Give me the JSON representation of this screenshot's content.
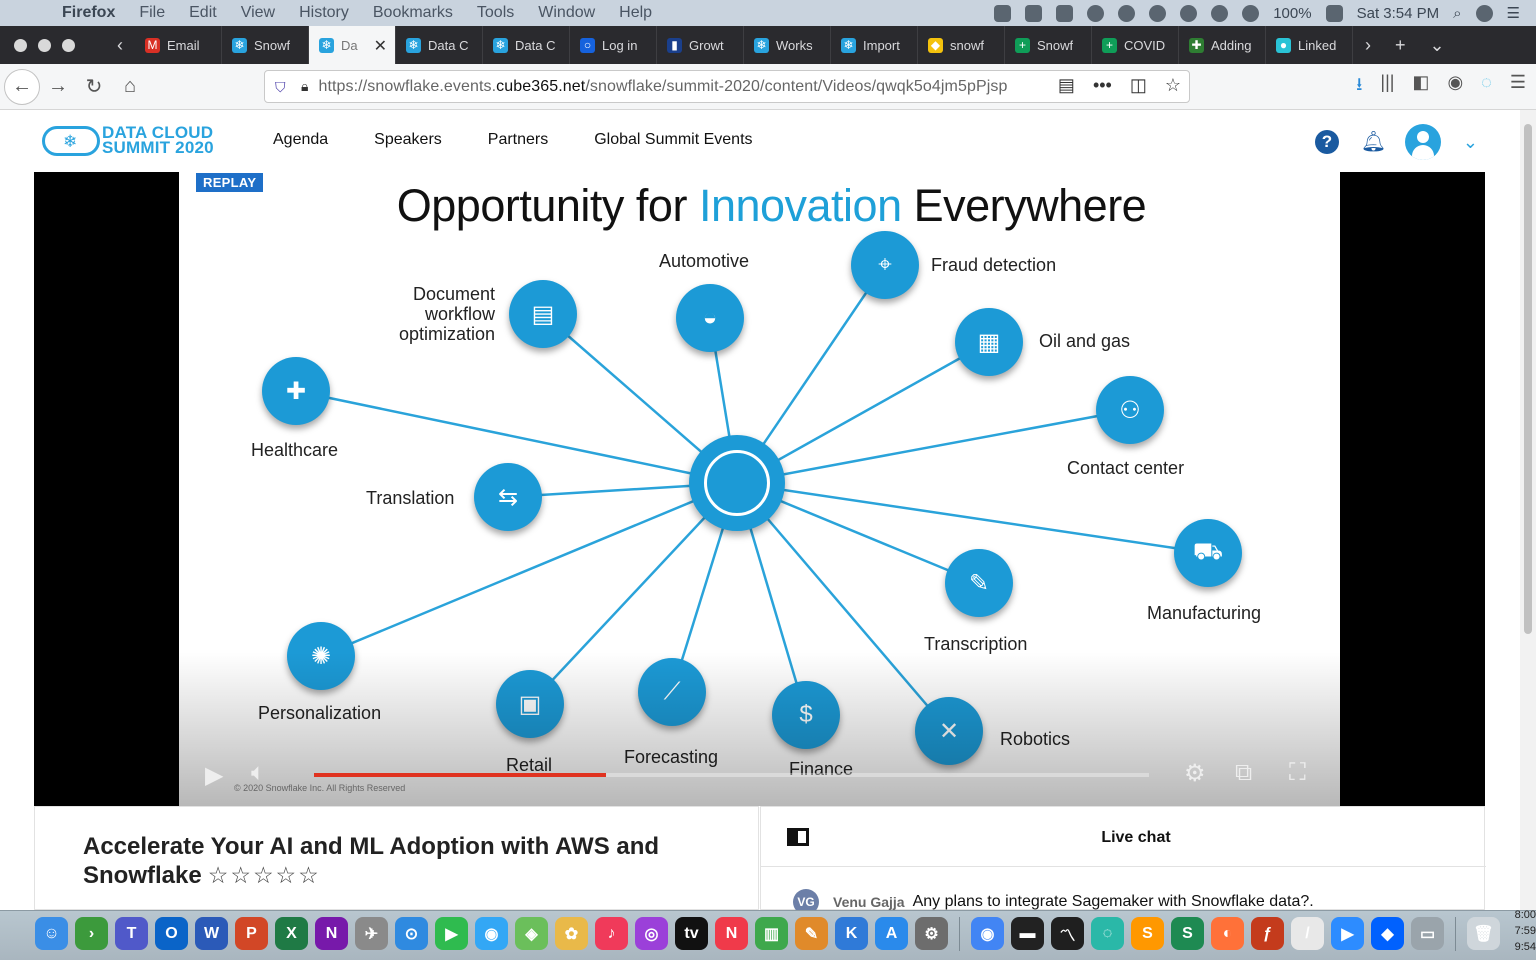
{
  "menubar": {
    "app": "Firefox",
    "items": [
      "File",
      "Edit",
      "View",
      "History",
      "Bookmarks",
      "Tools",
      "Window",
      "Help"
    ],
    "battery": "100%",
    "clock": "Sat 3:54 PM"
  },
  "tabs": [
    {
      "label": "Email",
      "icon": "gmail-icon",
      "color": "#d93025"
    },
    {
      "label": "Snowf",
      "icon": "snowflake-icon",
      "color": "#29a3de"
    },
    {
      "label": "Da",
      "icon": "snowflake-icon",
      "color": "#29a3de",
      "active": true
    },
    {
      "label": "Data C",
      "icon": "snowflake-icon",
      "color": "#29a3de"
    },
    {
      "label": "Data C",
      "icon": "snowflake-icon",
      "color": "#29a3de"
    },
    {
      "label": "Log in",
      "icon": "okta-icon",
      "color": "#1662dd"
    },
    {
      "label": "Growt",
      "icon": "chart-icon",
      "color": "#1a3f8c"
    },
    {
      "label": "Works",
      "icon": "snowflake-icon",
      "color": "#29a3de"
    },
    {
      "label": "Import",
      "icon": "snowflake-icon",
      "color": "#29a3de"
    },
    {
      "label": "snowf",
      "icon": "python-icon",
      "color": "#f4c20d"
    },
    {
      "label": "Snowf",
      "icon": "sheets-icon",
      "color": "#0f9d58"
    },
    {
      "label": "COVID",
      "icon": "sheets-icon",
      "color": "#0f9d58"
    },
    {
      "label": "Adding",
      "icon": "addon-icon",
      "color": "#2e7d32"
    },
    {
      "label": "Linked",
      "icon": "linkedin-icon",
      "color": "#2ac3d6"
    }
  ],
  "url": {
    "prefix": "https://snowflake.events.",
    "domain": "cube365.net",
    "path": "/snowflake/summit-2020/content/Videos/qwqk5o4jm5pPjsp"
  },
  "site": {
    "logo_line1": "DATA CLOUD",
    "logo_line2": "SUMMIT 2020",
    "nav": [
      "Agenda",
      "Speakers",
      "Partners",
      "Global Summit Events"
    ]
  },
  "video": {
    "badge": "REPLAY",
    "title_pre": "Opportunity for ",
    "title_highlight": "Innovation",
    "title_post": " Everywhere",
    "copyright": "© 2020 Snowflake Inc. All Rights Reserved",
    "progress": 0.35,
    "nodes": [
      {
        "label": "Document\nworkflow\noptimization",
        "icon": "document-icon"
      },
      {
        "label": "Automotive",
        "icon": "car-icon"
      },
      {
        "label": "Fraud detection",
        "icon": "fraud-icon"
      },
      {
        "label": "Oil and gas",
        "icon": "oil-icon"
      },
      {
        "label": "Contact center",
        "icon": "people-icon"
      },
      {
        "label": "Healthcare",
        "icon": "medkit-icon"
      },
      {
        "label": "Translation",
        "icon": "translate-icon"
      },
      {
        "label": "Manufacturing",
        "icon": "forklift-icon"
      },
      {
        "label": "Transcription",
        "icon": "transcribe-icon"
      },
      {
        "label": "Personalization",
        "icon": "person-icon"
      },
      {
        "label": "Retail",
        "icon": "register-icon"
      },
      {
        "label": "Forecasting",
        "icon": "trend-icon"
      },
      {
        "label": "Finance",
        "icon": "dollar-icon"
      },
      {
        "label": "Robotics",
        "icon": "robot-icon"
      }
    ]
  },
  "session": {
    "title": "Accelerate Your AI and ML Adoption with AWS and Snowflake",
    "stars": "☆☆☆☆☆"
  },
  "chat": {
    "title": "Live chat",
    "messages": [
      {
        "initials": "VG",
        "name": "Venu Gajja",
        "text": "Any plans to integrate Sagemaker with Snowflake data?."
      }
    ]
  },
  "dock_clock": [
    "8:00",
    "7:59",
    "9:54"
  ]
}
